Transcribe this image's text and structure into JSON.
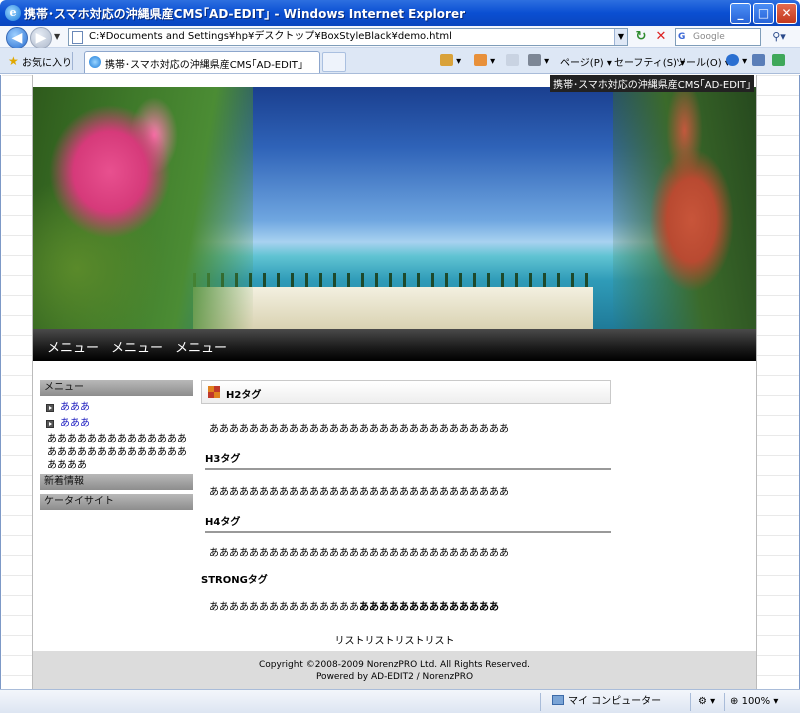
{
  "window": {
    "title": "携帯･スマホ対応の沖縄県産CMS｢AD-EDIT｣ - Windows Internet Explorer",
    "minimize": "_",
    "maximize": "□",
    "close": "✕"
  },
  "browser": {
    "address": "C:¥Documents and Settings¥hp¥デスクトップ¥BoxStyleBlack¥demo.html",
    "search_placeholder": "Google",
    "favorites_label": "お気に入り",
    "tab_title": "携帯･スマホ対応の沖縄県産CMS｢AD-EDIT｣",
    "tools": {
      "page": "ページ(P)",
      "safety": "セーフティ(S)",
      "tools": "ツール(O)"
    },
    "status_zone": "マイ コンピューター",
    "zoom": "100%"
  },
  "site": {
    "tagline": "携帯･スマホ対応の沖縄県産CMS｢AD-EDIT｣",
    "nav": [
      "メニュー",
      "メニュー",
      "メニュー"
    ],
    "sidebar": {
      "menu_heading": "メニュー",
      "links": [
        "あああ",
        "あああ"
      ],
      "text": "ああああああああああああああああああああああああああああああああ",
      "news_heading": "新着情報",
      "mobile_heading": "ケータイサイト"
    },
    "content": {
      "h2": "H2タグ",
      "p1": "ああああああああああああああああああああああああああああああ",
      "h3": "H3タグ",
      "p2": "ああああああああああああああああああああああああああああああ",
      "h4": "H4タグ",
      "p3": "ああああああああああああああああああああああああああああああ",
      "strong_heading": "STRONGタグ",
      "p4_normal": "あああああああああああああああ",
      "p4_bold": "ああああああああああああああ"
    },
    "list_text": "リストリストリストリスト",
    "footer": {
      "copyright": "Copyright ©2008-2009 NorenzPRO Ltd. All Rights Reserved.",
      "powered": "Powered by AD-EDIT2 / NorenzPRO"
    }
  },
  "colors": {
    "titlebar": "#0a4fd2",
    "nav_bg": "#1a1a1a",
    "link": "#2020c0",
    "footer_bg": "#dcdcdc"
  }
}
